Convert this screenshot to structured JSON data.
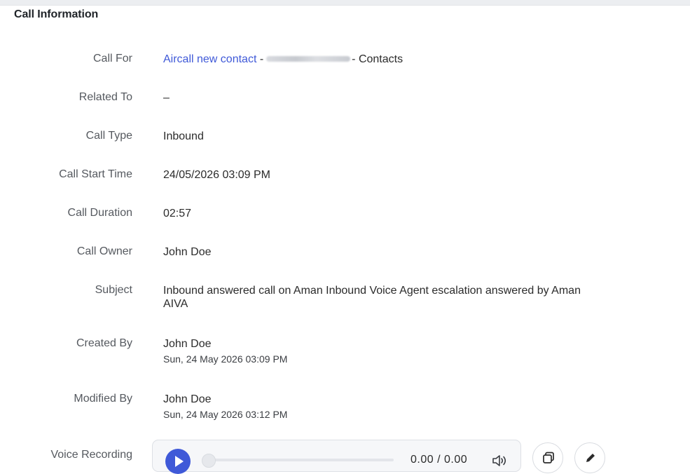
{
  "section": {
    "title": "Call Information"
  },
  "fields": {
    "call_for": {
      "label": "Call For",
      "link_text": "Aircall new contact",
      "separator": "-",
      "module": "- Contacts"
    },
    "related_to": {
      "label": "Related To",
      "value": "–"
    },
    "call_type": {
      "label": "Call Type",
      "value": "Inbound"
    },
    "call_start_time": {
      "label": "Call Start Time",
      "value": "24/05/2026 03:09 PM"
    },
    "call_duration": {
      "label": "Call Duration",
      "value": "02:57"
    },
    "call_owner": {
      "label": "Call Owner",
      "value": "John Doe"
    },
    "subject": {
      "label": "Subject",
      "value": "Inbound answered call on Aman Inbound Voice Agent escalation answered by Aman AIVA"
    },
    "created_by": {
      "label": "Created By",
      "name": "John Doe",
      "timestamp": "Sun, 24 May 2026 03:09 PM"
    },
    "modified_by": {
      "label": "Modified By",
      "name": "John Doe",
      "timestamp": "Sun, 24 May 2026 03:12 PM"
    },
    "voice_recording": {
      "label": "Voice Recording",
      "time_display": "0.00 / 0.00",
      "progress": 0
    }
  },
  "icons": {
    "play": "play-icon",
    "volume": "volume-icon",
    "copy": "copy-icon",
    "edit": "pencil-icon"
  },
  "colors": {
    "link": "#3f59d8",
    "play_button": "#3f59d8"
  }
}
